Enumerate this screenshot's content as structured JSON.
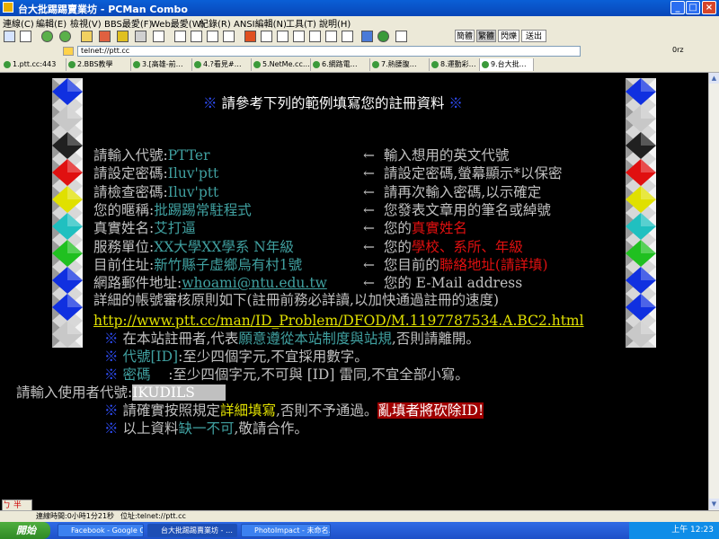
{
  "window": {
    "title": "台大批踢踢賣業坊 - PCMan Combo"
  },
  "menu": [
    "連線(C)",
    "編輯(E)",
    "檢視(V)",
    "BBS最愛(F)",
    "Web最愛(W)",
    "紀錄(R)",
    "ANSI編輯(N)",
    "工具(T)",
    "說明(H)"
  ],
  "toolbar_right": {
    "simp": "簡體",
    "trad": "繁體",
    "flash": "閃爍",
    "send": "送出"
  },
  "address": {
    "label": "telnet",
    "value": "telnet://ptt.cc",
    "zoom": "0rz"
  },
  "tabs": [
    "1.ptt.cc:443",
    "2.BBS教學",
    "3.[高雄-前…",
    "4.?看見#…",
    "5.NetMe.cc…",
    "6.網路電…",
    "7.熱腰腹…",
    "8.運動彩…",
    "9.台大批…"
  ],
  "terminal": {
    "heading": "請參考下列的範例填寫您的註冊資料",
    "star": "※",
    "examples": [
      {
        "label": "請輸入代號:",
        "value": "PTTer",
        "arrow": "←",
        "desc": "輸入想用的英文代號",
        "desc_hl": "",
        "desc_tail": ""
      },
      {
        "label": "請設定密碼:",
        "value": "Iluv'ptt",
        "arrow": "←",
        "desc": "請設定密碼,螢幕顯示*以保密",
        "desc_hl": "",
        "desc_tail": ""
      },
      {
        "label": "請檢查密碼:",
        "value": "Iluv'ptt",
        "arrow": "←",
        "desc": "請再次輸入密碼,以示確定",
        "desc_hl": "",
        "desc_tail": ""
      },
      {
        "label": "您的暱稱:",
        "value": "批踢踢常駐程式",
        "arrow": "←",
        "desc": "您發表文章用的筆名或綽號",
        "desc_hl": "",
        "desc_tail": ""
      },
      {
        "label": "真實姓名:",
        "value": "艾打逼",
        "arrow": "←",
        "desc": "您的",
        "desc_hl": "真實姓名",
        "desc_tail": ""
      },
      {
        "label": "服務單位:",
        "value": "XX大學XX學系 N年級",
        "arrow": "←",
        "desc": "您的",
        "desc_hl": "學校、系所、年級",
        "desc_tail": ""
      },
      {
        "label": "目前住址:",
        "value": "新竹縣子虛鄉烏有村1號",
        "arrow": "←",
        "desc": "您目前的",
        "desc_hl": "聯絡地址",
        "desc_tail": "(請詳填)"
      },
      {
        "label": "網路郵件地址:",
        "value": "whoami@ntu.edu.tw",
        "arrow": "←",
        "desc": "您的 E-Mail address",
        "desc_hl": "",
        "desc_tail": ""
      }
    ],
    "detail_text": "詳細的帳號審核原則如下(註冊前務必詳讀,以加快通過註冊的速度)",
    "url": "http://www.ptt.cc/man/ID_Problem/DFOD/M.1197787534.A.BC2.html",
    "rule1_pre": "在本站註冊者,代表",
    "rule1_hl": "願意遵從本站制度與站規",
    "rule1_post": ",否則請離開。",
    "rule2_label": "代號[ID]",
    "rule2_text": ":至少四個字元,不宜採用數字。",
    "rule3_label": "密碼",
    "rule3_text": ":至少四個字元,不可與 [ID] 雷同,不宜全部小寫。",
    "prompt_label": "請輸入使用者代號:",
    "prompt_value": "IKUDILS",
    "rule4_pre": "請確實按照規定",
    "rule4_hl": "詳細填寫",
    "rule4_post": ",否則不予通過。",
    "rule4_warn": "亂填者將砍除ID!",
    "rule5_pre": "以上資料",
    "rule5_hl": "缺一不可",
    "rule5_post": ",敬請合作。"
  },
  "status": {
    "time": "連線時間:0小時1分21秒",
    "position": "位址:telnet://ptt.cc"
  },
  "ime": "ㄅ 半",
  "taskbar": {
    "start": "開始",
    "items": [
      "Facebook - Google Ch…",
      "台大批踢踢賣業坊 - …",
      "PhotoImpact - 未命名…"
    ],
    "clock": "上午 12:23"
  },
  "colors": {
    "titlebar": "#0a5fd6",
    "terminal_bg": "#000000",
    "text_gray": "#c0c0c0",
    "text_cyan": "#40a0a0",
    "text_red": "#e01010",
    "text_yellow": "#e0e000"
  }
}
